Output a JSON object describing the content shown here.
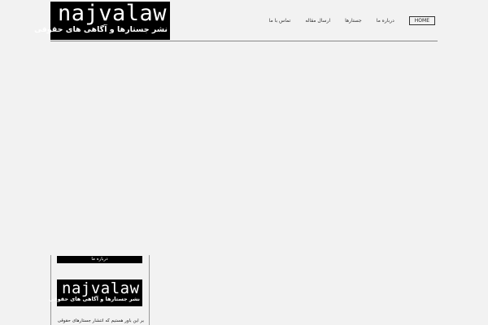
{
  "header": {
    "logo": {
      "wordmark": "najvalaw",
      "tagline": "نشر جستارها و آگاهی های حقوقی"
    },
    "nav": [
      {
        "label": "HOME",
        "active": true
      },
      {
        "label": "درباره ما",
        "active": false
      },
      {
        "label": "جستارها",
        "active": false
      },
      {
        "label": "ارسال مقاله",
        "active": false
      },
      {
        "label": "تماس با ما",
        "active": false
      }
    ]
  },
  "sidebar_widget": {
    "title": "درباره ما",
    "logo": {
      "wordmark": "najvalaw",
      "tagline": "نشر جستارها و آگاهی های حقوقی"
    },
    "text": "بر این باور هستیم که انتشار جستارهای حقوقی"
  }
}
